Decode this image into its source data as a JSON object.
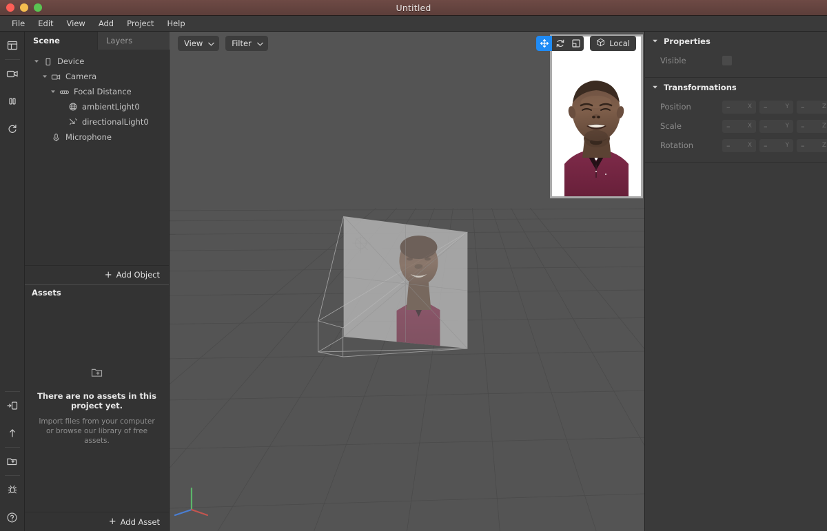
{
  "window": {
    "title": "Untitled",
    "traffic_lights": [
      "close",
      "minimize",
      "zoom"
    ],
    "accent_blue": "#1f8bf5",
    "titlebar_color": "#5c3e3a"
  },
  "menubar": {
    "items": [
      "File",
      "Edit",
      "View",
      "Add",
      "Project",
      "Help"
    ]
  },
  "rail": {
    "top_items": [
      {
        "name": "layout-panels-icon",
        "title": "Toggle panels"
      },
      {
        "name": "video-camera-icon",
        "title": "Video"
      },
      {
        "name": "pause-icon",
        "title": "Pause"
      },
      {
        "name": "reload-icon",
        "title": "Restart"
      }
    ],
    "bottom_items": [
      {
        "name": "send-to-device-icon",
        "title": "Test on device"
      },
      {
        "name": "upload-icon",
        "title": "Upload"
      },
      {
        "name": "add-folder-icon",
        "title": "Add asset"
      },
      {
        "name": "bug-icon",
        "title": "Debug"
      },
      {
        "name": "help-icon",
        "title": "Help"
      }
    ]
  },
  "leftpanel": {
    "tabs": [
      {
        "label": "Scene",
        "active": true
      },
      {
        "label": "Layers",
        "active": false
      }
    ],
    "tree": [
      {
        "label": "Device",
        "depth": 0,
        "icon": "device-icon",
        "expanded": true
      },
      {
        "label": "Camera",
        "depth": 1,
        "icon": "camera-icon",
        "expanded": true
      },
      {
        "label": "Focal Distance",
        "depth": 2,
        "icon": "focal-distance-icon",
        "expanded": true
      },
      {
        "label": "ambientLight0",
        "depth": 3,
        "icon": "ambient-light-icon",
        "expanded": null
      },
      {
        "label": "directionalLight0",
        "depth": 3,
        "icon": "directional-light-icon",
        "expanded": null
      },
      {
        "label": "Microphone",
        "depth": 1,
        "icon": "microphone-icon",
        "expanded": null
      }
    ],
    "add_object_label": "Add Object",
    "add_object_plus": "+",
    "assets_title": "Assets",
    "assets_empty_title": "There are no assets in this project yet.",
    "assets_empty_subtitle": "Import files from your computer or browse our library of free assets.",
    "add_asset_label": "Add Asset",
    "add_asset_plus": "+"
  },
  "viewport": {
    "view_dropdown": "View",
    "filter_dropdown": "Filter",
    "transform_tools": [
      {
        "name": "move-tool",
        "active": true
      },
      {
        "name": "rotate-tool",
        "active": false
      },
      {
        "name": "scale-tool",
        "active": false
      }
    ],
    "coordinate_space_label": "Local",
    "axis_gizmo": {
      "x_color": "#4a7fd4",
      "y_color": "#5bb56a",
      "z_color": "#c4554f"
    },
    "grid_color": "#4a4a4a",
    "background_color": "#545454"
  },
  "preview": {
    "name": "device-preview",
    "background": "#ffffff"
  },
  "inspector": {
    "sections": [
      {
        "title": "Properties",
        "expanded": true,
        "rows": [
          {
            "label": "Visible",
            "type": "checkbox",
            "checked": false
          }
        ]
      },
      {
        "title": "Transformations",
        "expanded": true,
        "rows": [
          {
            "label": "Position",
            "type": "xyz",
            "values": [
              "–",
              "–",
              "–"
            ],
            "axes": [
              "X",
              "Y",
              "Z"
            ]
          },
          {
            "label": "Scale",
            "type": "xyz",
            "values": [
              "–",
              "–",
              "–"
            ],
            "axes": [
              "X",
              "Y",
              "Z"
            ]
          },
          {
            "label": "Rotation",
            "type": "xyz",
            "values": [
              "–",
              "–",
              "–"
            ],
            "axes": [
              "X",
              "Y",
              "Z"
            ]
          }
        ]
      }
    ]
  }
}
